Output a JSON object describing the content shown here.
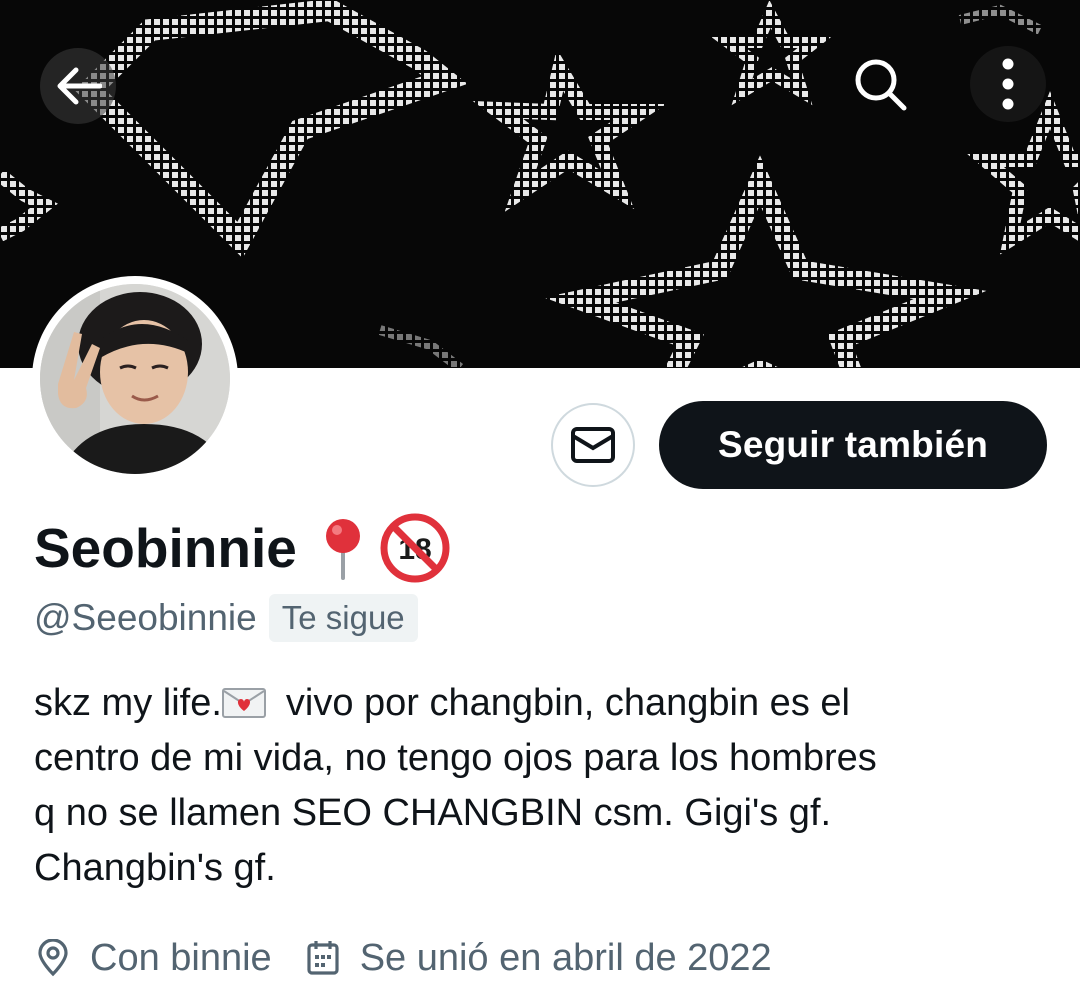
{
  "profile": {
    "display_name": "Seobinnie",
    "name_emojis": [
      "round-pushpin",
      "no-one-under-eighteen"
    ],
    "handle": "@Seeobinnie",
    "follows_you_label": "Te sigue",
    "bio": {
      "line1_before_emoji": "skz my life.",
      "line1_after_emoji": "vivo por changbin, changbin es el",
      "line2": "centro de mi vida, no tengo ojos para los hombres",
      "line3": "q no se llamen SEO CHANGBIN csm.  Gigi's gf.",
      "line4": "Changbin's gf."
    },
    "location": "Con binnie",
    "joined": "Se unió en abril de 2022"
  },
  "actions": {
    "follow_label": "Seguir también"
  },
  "icons": {
    "back": "arrow-left-icon",
    "search": "search-icon",
    "more": "more-vertical-icon",
    "message": "envelope-icon",
    "location": "location-pin-icon",
    "calendar": "calendar-icon"
  },
  "colors": {
    "text": "#0f1419",
    "secondary": "#536471",
    "button_dark": "#0f1419",
    "badge_bg": "#eff3f4"
  }
}
